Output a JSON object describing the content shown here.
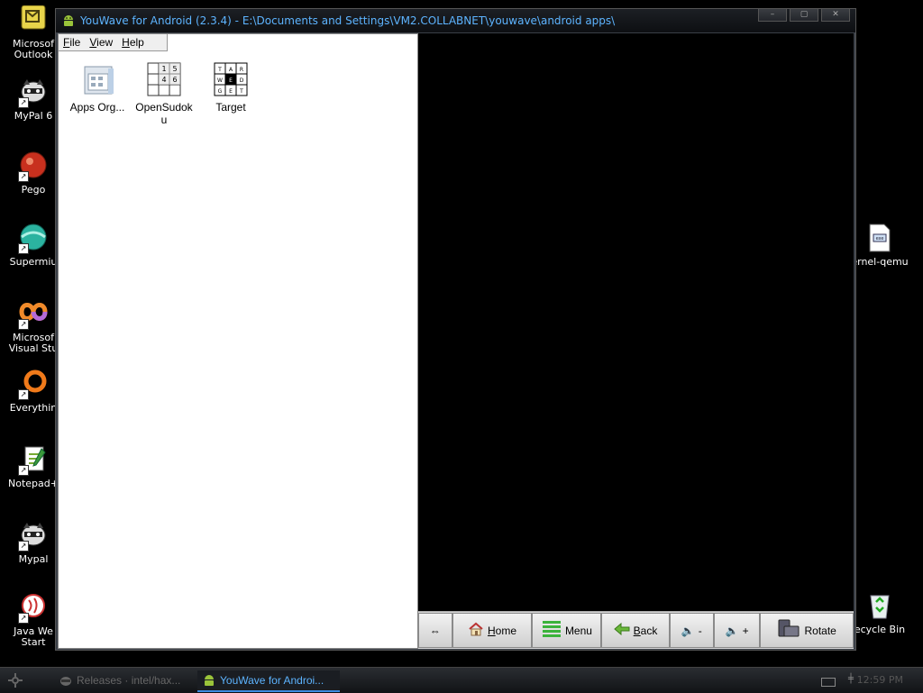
{
  "desktop": {
    "icons": [
      {
        "name": "outlook",
        "label": "Microsof\nOutlook"
      },
      {
        "name": "mypal",
        "label": "MyPal 6"
      },
      {
        "name": "pego",
        "label": "Pego"
      },
      {
        "name": "supermium",
        "label": "Supermiu"
      },
      {
        "name": "visual-studio",
        "label": "Microsof\nVisual Stu"
      },
      {
        "name": "everything",
        "label": "Everythin"
      },
      {
        "name": "notepad",
        "label": "Notepad+"
      },
      {
        "name": "mypal2",
        "label": "Mypal"
      },
      {
        "name": "java-web-start",
        "label": "Java We\nStart"
      },
      {
        "name": "kernel-qemu",
        "label": "ernel-qemu"
      },
      {
        "name": "recycle-bin",
        "label": "ecycle Bin"
      }
    ]
  },
  "window": {
    "title": "YouWave for Android (2.3.4) - E:\\Documents and Settings\\VM2.COLLABNET\\youwave\\android apps\\",
    "menu": {
      "file": {
        "u": "F",
        "rest": "ile"
      },
      "view": {
        "u": "V",
        "rest": "iew"
      },
      "help": {
        "u": "H",
        "rest": "elp"
      }
    },
    "apps": [
      {
        "label": "Apps Org..."
      },
      {
        "label": "OpenSudok\nu"
      },
      {
        "label": "Target"
      }
    ],
    "navbar": {
      "home": {
        "u": "H",
        "rest": "ome"
      },
      "menu": "Menu",
      "back": {
        "u": "B",
        "rest": "ack"
      },
      "vol_down": "-",
      "vol_up": "+",
      "rotate": "Rotate"
    },
    "sudoku_digits": [
      "1",
      "5",
      "4",
      "6"
    ],
    "target_letters": [
      "T",
      "A",
      "R",
      "W",
      "E",
      "D",
      "G",
      "E",
      "T"
    ]
  },
  "taskbar": {
    "tasks": [
      {
        "label": "Releases · intel/hax..."
      },
      {
        "label": "YouWave for Androi..."
      }
    ],
    "clock": "12:59 PM"
  },
  "colors": {
    "title": "#5db4ff",
    "accent": "#3a8be0"
  }
}
